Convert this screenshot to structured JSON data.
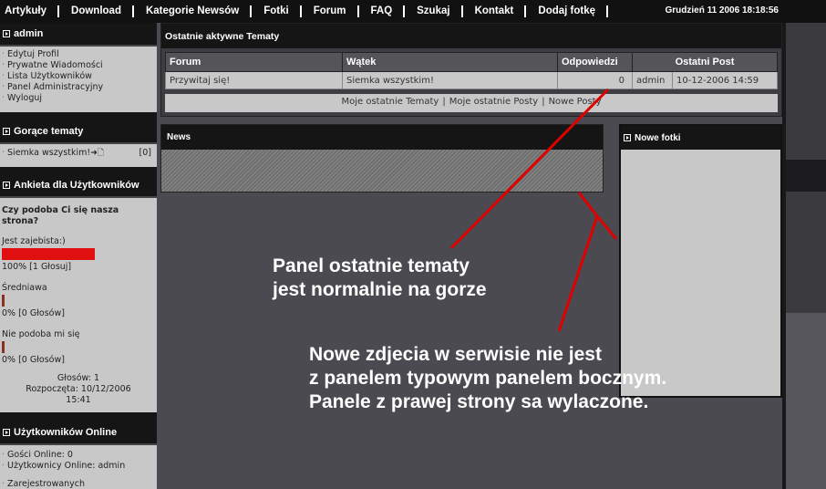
{
  "nav": {
    "items": [
      "Artykuły",
      "Download",
      "Kategorie Newsów",
      "Fotki",
      "Forum",
      "FAQ",
      "Szukaj",
      "Kontakt",
      "Dodaj fotkę"
    ],
    "datetime": "Grudzień 11 2006 18:18:56"
  },
  "sidebar": {
    "user_panel": {
      "title": "admin",
      "links": [
        "Edytuj Profil",
        "Prywatne Wiadomości",
        "Lista Użytkowników",
        "Panel Administracyjny",
        "Wyloguj"
      ]
    },
    "hot_topics": {
      "title": "Gorące tematy",
      "topic": "Siemka wszystkim!",
      "count": "[0]"
    },
    "poll": {
      "title": "Ankieta dla Użytkowników",
      "question": "Czy podoba Ci się nasza strona?",
      "options": [
        {
          "label": "Jest zajebista:)",
          "result": "100% [1 Głosuj]",
          "percent": 100
        },
        {
          "label": "Średniawa",
          "result": "0% [0 Głosów]",
          "percent": 0
        },
        {
          "label": "Nie podoba mi się",
          "result": "0% [0 Głosów]",
          "percent": 0
        }
      ],
      "votes": "Głosów: 1",
      "started_line1": "Rozpoczęta: 10/12/2006",
      "started_line2": "15:41"
    },
    "online": {
      "title": "Użytkowników Online",
      "guests": "Gości Online: 0",
      "users": "Użytkownicy Online: admin",
      "registered": "Zarejestrowanych"
    }
  },
  "main": {
    "title": "Ostatnie aktywne Tematy",
    "columns": [
      "Forum",
      "Wątek",
      "Odpowiedzi",
      "Ostatni Post"
    ],
    "rows": [
      {
        "forum": "Przywitaj się!",
        "thread": "Siemka wszystkim!",
        "replies": "0",
        "user": "admin",
        "date": "10-12-2006 14:59"
      }
    ],
    "links": [
      "Moje ostatnie Tematy",
      "Moje ostatnie Posty",
      "Nowe Posty"
    ]
  },
  "news": {
    "title": "News"
  },
  "photos": {
    "title": "Nowe fotki"
  },
  "annotations": {
    "note1": [
      "Panel ostatnie tematy",
      "jest normalnie na gorze"
    ],
    "note2": [
      "Nowe zdjecia w serwisie nie jest",
      "z panelem typowym panelem bocznym.",
      "Panele z prawej strony sa wylaczone."
    ]
  },
  "colors": {
    "annotation_arrow": "#e00000",
    "poll_bar": "#e01010"
  }
}
